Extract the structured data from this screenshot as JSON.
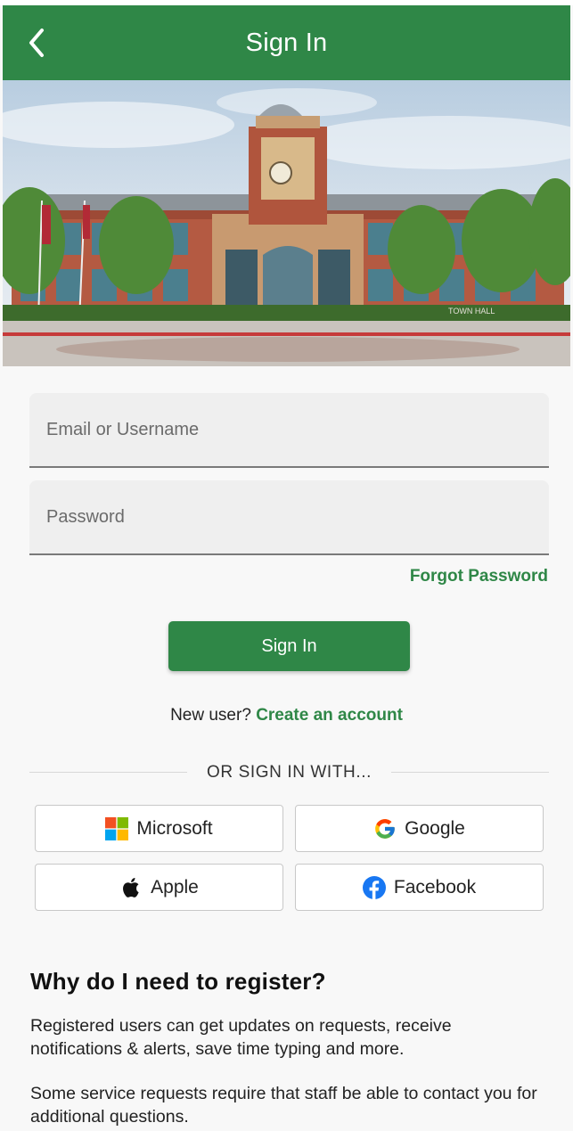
{
  "header": {
    "title": "Sign In",
    "back_icon": "chevron-left-icon"
  },
  "hero": {
    "sign_text": "TOWN HALL"
  },
  "form": {
    "email_placeholder": "Email or Username",
    "email_value": "",
    "password_placeholder": "Password",
    "password_value": "",
    "forgot_label": "Forgot Password",
    "signin_label": "Sign In",
    "new_user_text": "New user?",
    "create_account_label": "Create an account"
  },
  "social": {
    "divider_text": "OR SIGN IN WITH...",
    "buttons": [
      {
        "label": "Microsoft",
        "icon": "microsoft-icon"
      },
      {
        "label": "Google",
        "icon": "google-icon"
      },
      {
        "label": "Apple",
        "icon": "apple-icon"
      },
      {
        "label": "Facebook",
        "icon": "facebook-icon"
      }
    ]
  },
  "info": {
    "heading": "Why do I need to register?",
    "paragraph1": "Registered users can get updates on requests, receive notifications & alerts, save time typing and more.",
    "paragraph2": "Some service requests require that staff be able to contact you for additional questions."
  },
  "colors": {
    "primary": "#2f8747",
    "field_bg": "#efefef",
    "page_bg": "#f8f8f8"
  }
}
